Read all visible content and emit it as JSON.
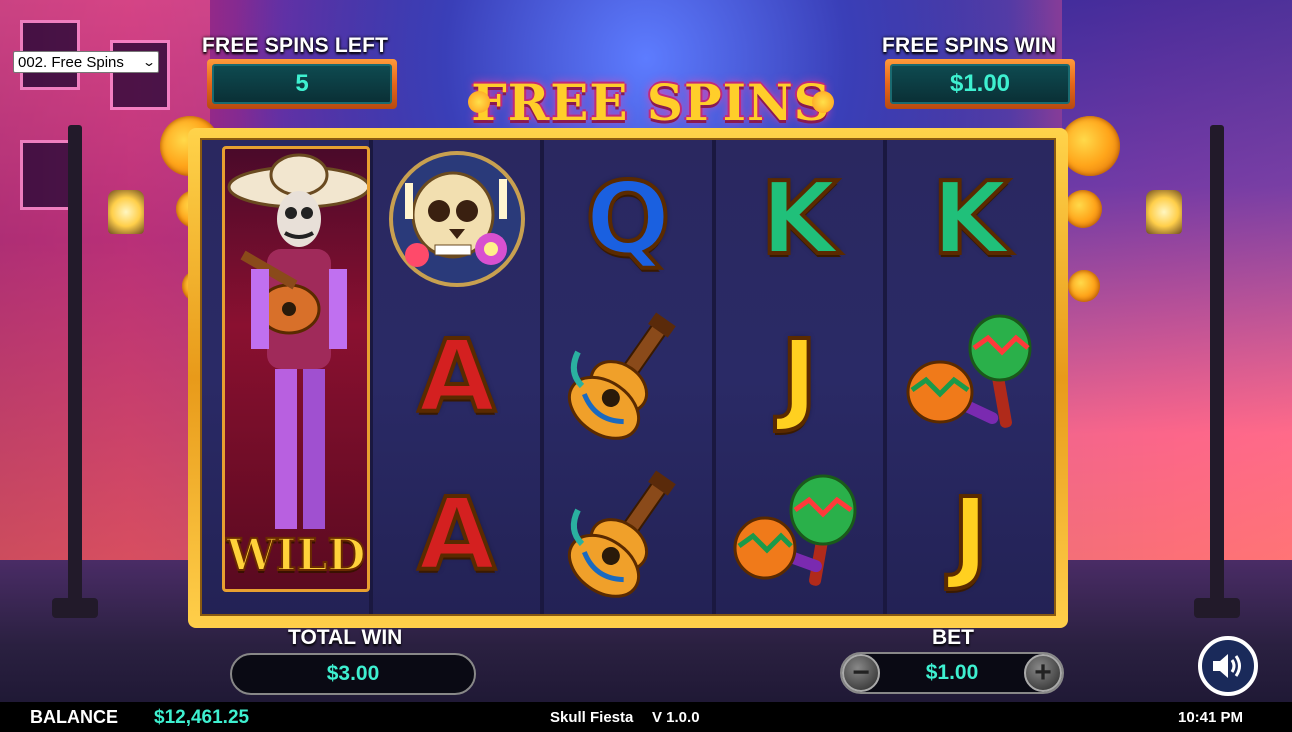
{
  "mode_select": {
    "selected": "002. Free Spins"
  },
  "counters": {
    "free_spins_left_label": "FREE SPINS LEFT",
    "free_spins_left_value": "5",
    "free_spins_win_label": "FREE SPINS WIN",
    "free_spins_win_value": "$1.00"
  },
  "title": {
    "text": "FREE SPINS"
  },
  "reels": [
    {
      "cells": [
        {
          "symbol": "wild-mariachi"
        }
      ]
    },
    {
      "cells": [
        {
          "symbol": "skull"
        },
        {
          "symbol": "A"
        },
        {
          "symbol": "A"
        }
      ]
    },
    {
      "cells": [
        {
          "symbol": "Q"
        },
        {
          "symbol": "guitar"
        },
        {
          "symbol": "guitar"
        }
      ]
    },
    {
      "cells": [
        {
          "symbol": "K"
        },
        {
          "symbol": "J"
        },
        {
          "symbol": "maracas"
        }
      ]
    },
    {
      "cells": [
        {
          "symbol": "K"
        },
        {
          "symbol": "maracas"
        },
        {
          "symbol": "J"
        }
      ]
    }
  ],
  "symbols": {
    "wild_label": "WILD",
    "q": "Q",
    "k": "K",
    "a": "A",
    "j": "J"
  },
  "total_win": {
    "label": "TOTAL WIN",
    "value": "$3.00"
  },
  "bet": {
    "label": "BET",
    "value": "$1.00",
    "minus": "−",
    "plus": "+"
  },
  "status": {
    "balance_label": "BALANCE",
    "balance_value": "$12,461.25",
    "game_name": "Skull Fiesta",
    "version": "V 1.0.0",
    "time": "10:41 PM"
  },
  "colors": {
    "accent_teal": "#3ef0d0",
    "frame_gold": "#ffd34a",
    "label_white": "#ffffff"
  }
}
